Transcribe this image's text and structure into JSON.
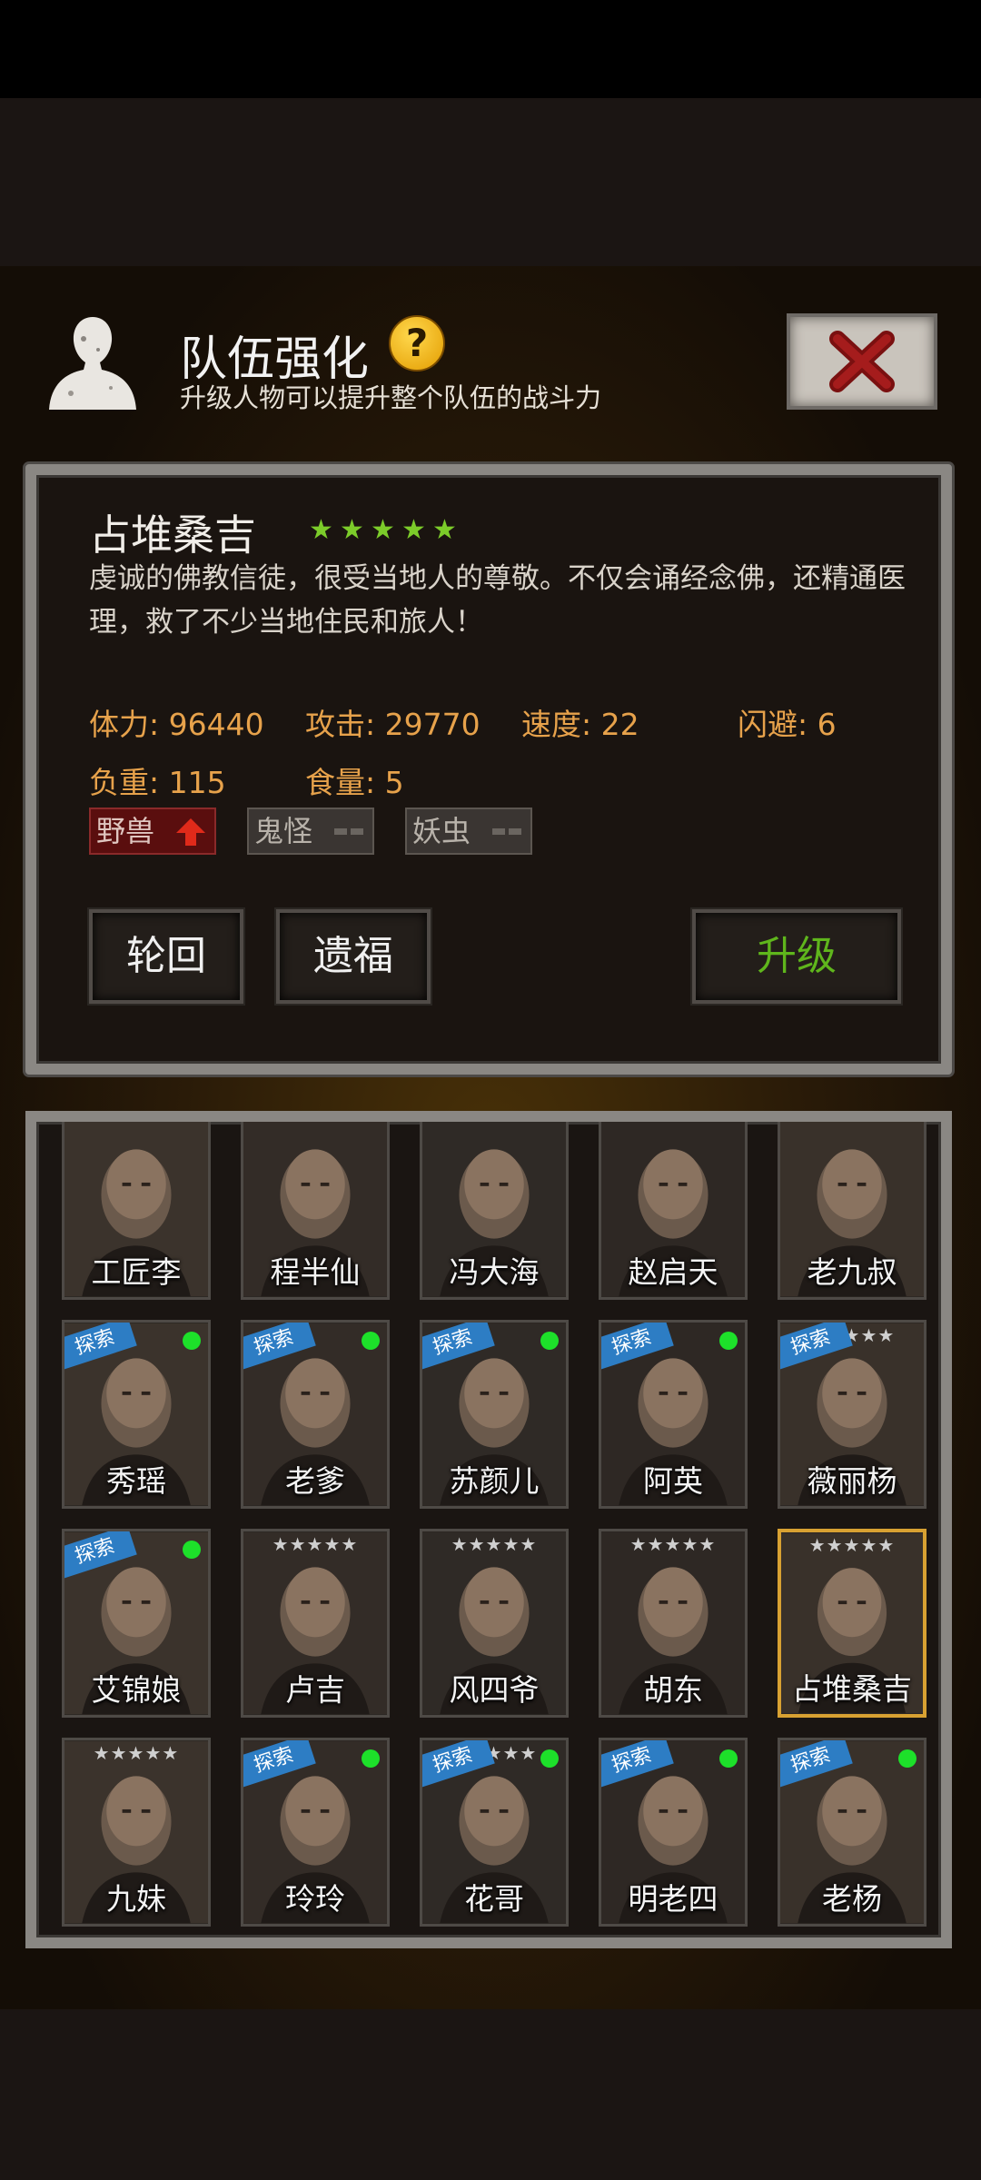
{
  "header": {
    "title": "队伍强化",
    "help_icon": "?",
    "subtitle": "升级人物可以提升整个队伍的战斗力"
  },
  "hero": {
    "name": "占堆桑吉",
    "star_count": 5,
    "description": "虔诚的佛教信徒，很受当地人的尊敬。不仅会诵经念佛，还精通医理，救了不少当地住民和旅人！",
    "stats": {
      "hp": "体力: 96440",
      "attack": "攻击: 29770",
      "speed": "速度: 22",
      "dodge": "闪避: 6",
      "load": "负重: 115",
      "food": "食量: 5"
    },
    "tags": [
      {
        "label": "野兽",
        "state": "up"
      },
      {
        "label": "鬼怪",
        "state": "neutral"
      },
      {
        "label": "妖虫",
        "state": "neutral"
      }
    ]
  },
  "buttons": {
    "reincarnation": "轮回",
    "legacy": "遗福",
    "upgrade": "升级"
  },
  "ribbon_label": "探索",
  "star_glyphs": "★★★★★",
  "roster": [
    {
      "name": "工匠李",
      "explore": false,
      "online": false,
      "stars": false
    },
    {
      "name": "程半仙",
      "explore": false,
      "online": false,
      "stars": false
    },
    {
      "name": "冯大海",
      "explore": false,
      "online": false,
      "stars": false
    },
    {
      "name": "赵启天",
      "explore": false,
      "online": false,
      "stars": false
    },
    {
      "name": "老九叔",
      "explore": false,
      "online": false,
      "stars": false
    },
    {
      "name": "秀瑶",
      "explore": true,
      "online": true,
      "stars": false
    },
    {
      "name": "老爹",
      "explore": true,
      "online": true,
      "stars": false
    },
    {
      "name": "苏颜儿",
      "explore": true,
      "online": true,
      "stars": false
    },
    {
      "name": "阿英",
      "explore": true,
      "online": true,
      "stars": false
    },
    {
      "name": "薇丽杨",
      "explore": true,
      "online": false,
      "stars": true
    },
    {
      "name": "艾锦娘",
      "explore": true,
      "online": true,
      "stars": false
    },
    {
      "name": "卢吉",
      "explore": false,
      "online": false,
      "stars": true
    },
    {
      "name": "风四爷",
      "explore": false,
      "online": false,
      "stars": true
    },
    {
      "name": "胡东",
      "explore": false,
      "online": false,
      "stars": true
    },
    {
      "name": "占堆桑吉",
      "explore": false,
      "online": false,
      "stars": true,
      "selected": true
    },
    {
      "name": "九妹",
      "explore": false,
      "online": false,
      "stars": true
    },
    {
      "name": "玲玲",
      "explore": true,
      "online": true,
      "stars": false
    },
    {
      "name": "花哥",
      "explore": true,
      "online": true,
      "stars": true
    },
    {
      "name": "明老四",
      "explore": true,
      "online": true,
      "stars": false
    },
    {
      "name": "老杨",
      "explore": true,
      "online": true,
      "stars": false
    },
    {
      "name": "",
      "explore": true,
      "online": false,
      "stars": true
    },
    {
      "name": "",
      "explore": true,
      "online": true,
      "stars": false
    },
    {
      "name": "",
      "explore": true,
      "online": true,
      "stars": false
    },
    {
      "name": "",
      "explore": true,
      "online": true,
      "stars": false
    },
    {
      "name": "",
      "explore": true,
      "online": true,
      "stars": false
    }
  ],
  "colors": {
    "stat_text": "#e7a24b",
    "upgrade_text": "#5fb61c",
    "star_green": "#7ccc2a",
    "online_dot": "#1de02a",
    "explore_ribbon": "#2d7dc4",
    "selected_border": "#d8a132"
  }
}
